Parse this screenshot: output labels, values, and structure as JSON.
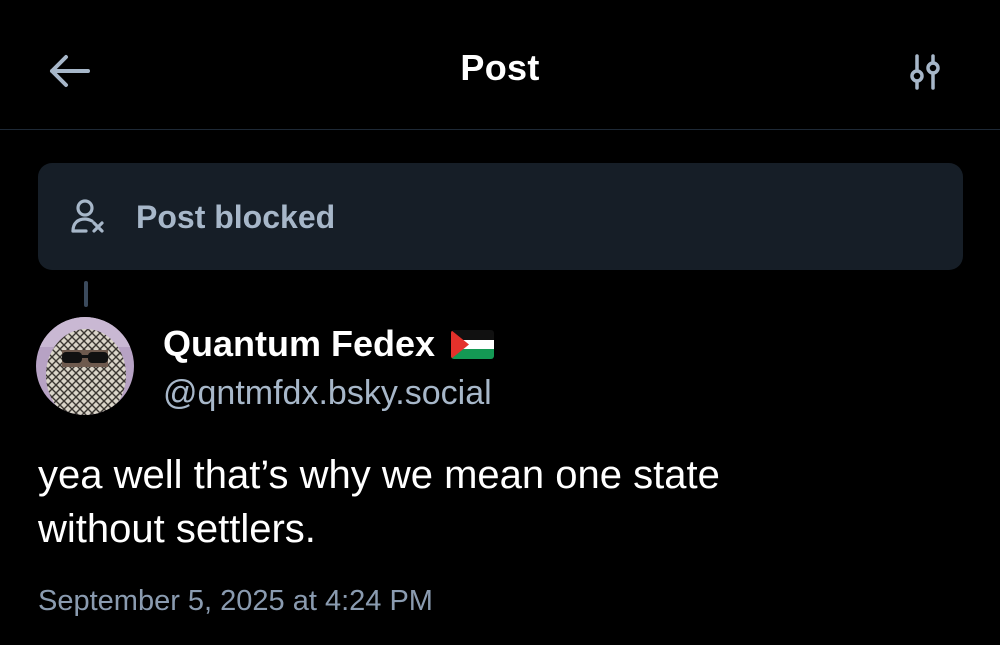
{
  "header": {
    "title": "Post",
    "back_icon": "arrow-left-icon",
    "settings_icon": "sliders-icon"
  },
  "blocked_notice": {
    "icon": "person-x-icon",
    "label": "Post blocked"
  },
  "post": {
    "author": {
      "display_name": "Quantum Fedex",
      "badge_icon": "palestine-flag-icon",
      "handle": "@qntmfdx.bsky.social"
    },
    "text_line1": "yea well that’s why we mean one state",
    "text_line2": "without settlers.",
    "timestamp": "September 5, 2025 at 4:24 PM"
  },
  "colors": {
    "background": "#000000",
    "card": "#161e27",
    "muted_text": "#a7b7c9",
    "date_text": "#8a9bb0",
    "divider": "#1e2936",
    "thread_line": "#3b4a5c"
  }
}
